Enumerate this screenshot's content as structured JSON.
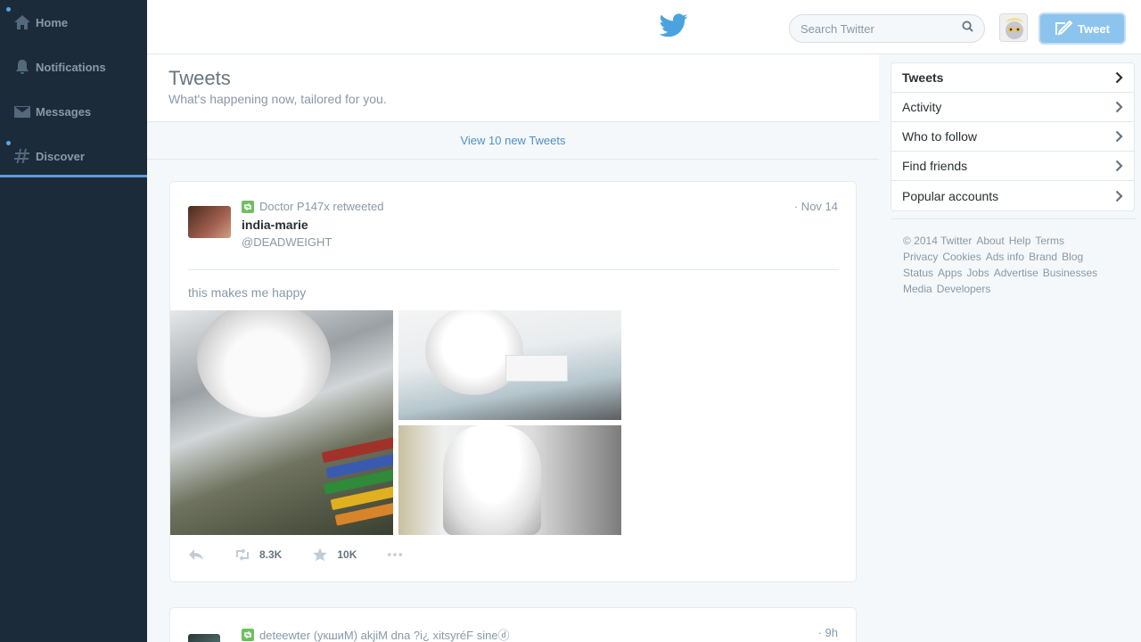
{
  "sidebar": {
    "items": [
      {
        "label": "Home",
        "icon": "home-icon"
      },
      {
        "label": "Notifications",
        "icon": "bell-icon"
      },
      {
        "label": "Messages",
        "icon": "envelope-icon"
      },
      {
        "label": "Discover",
        "icon": "hashtag-icon"
      }
    ]
  },
  "topbar": {
    "logo": "twitter-bird-icon",
    "search_placeholder": "Search Twitter",
    "tweet_button": "Tweet"
  },
  "header": {
    "title": "Tweets",
    "subtitle": "What's happening now, tailored for you."
  },
  "new_tweets": "View 10 new Tweets",
  "tweets": [
    {
      "retweeted_by": "Doctor P147x retweeted",
      "name": "india-marie",
      "handle": "@DEADWEIGHT",
      "date": "· Nov 14",
      "text": "this makes me happy",
      "retweets": "8.3K",
      "favorites": "10K"
    },
    {
      "retweeted_by": "deteewter (укшиМ) akjiM dna ?i¿ xitsyréF sineⓓ",
      "date": "· 9h"
    }
  ],
  "right_nav": {
    "items": [
      "Tweets",
      "Activity",
      "Who to follow",
      "Find friends",
      "Popular accounts"
    ]
  },
  "footer": {
    "links": [
      "© 2014 Twitter",
      "About",
      "Help",
      "Terms",
      "Privacy",
      "Cookies",
      "Ads info",
      "Brand",
      "Blog",
      "Status",
      "Apps",
      "Jobs",
      "Advertise",
      "Businesses",
      "Media",
      "Developers"
    ]
  },
  "colors": {
    "sidebar_bg": "#1c2b3a",
    "accent": "#4aa3df",
    "retweet_green": "#6fbf5f"
  }
}
